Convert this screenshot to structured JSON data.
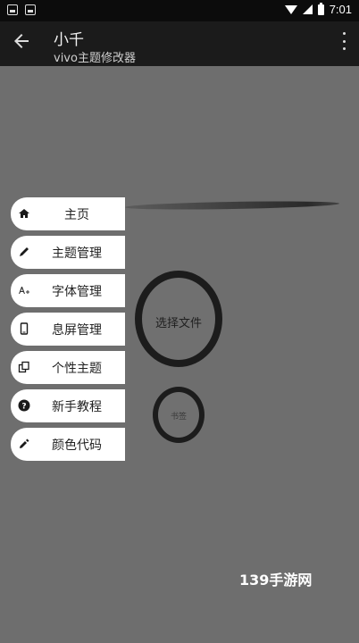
{
  "status_bar": {
    "time": "7:01"
  },
  "toolbar": {
    "title": "小千",
    "subtitle": "vivo主题修改器"
  },
  "menu": {
    "items": [
      {
        "label": "主页",
        "icon": "home-icon"
      },
      {
        "label": "主题管理",
        "icon": "pencil-icon"
      },
      {
        "label": "字体管理",
        "icon": "font-icon"
      },
      {
        "label": "息屏管理",
        "icon": "phone-icon"
      },
      {
        "label": "个性主题",
        "icon": "copy-icon"
      },
      {
        "label": "新手教程",
        "icon": "help-icon"
      },
      {
        "label": "颜色代码",
        "icon": "eyedropper-icon"
      }
    ]
  },
  "actions": {
    "select_file": "选择文件",
    "small_label": "书签"
  },
  "watermark": "139手游网"
}
